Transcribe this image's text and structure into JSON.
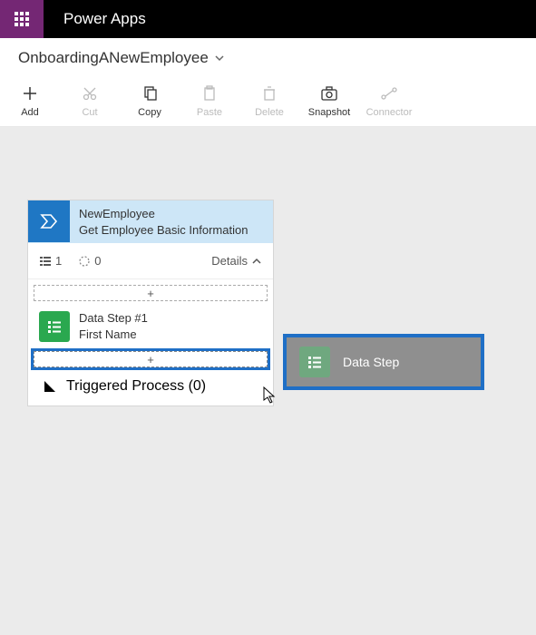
{
  "header": {
    "app_title": "Power Apps"
  },
  "breadcrumb": {
    "title": "OnboardingANewEmployee"
  },
  "toolbar": {
    "add": "Add",
    "cut": "Cut",
    "copy": "Copy",
    "paste": "Paste",
    "delete": "Delete",
    "snapshot": "Snapshot",
    "connector": "Connector"
  },
  "stage": {
    "title_line1": "NewEmployee",
    "title_line2": "Get Employee Basic Information",
    "meta": {
      "steps_count": "1",
      "pending_count": "0",
      "details_label": "Details"
    },
    "dropzone_plus": "+",
    "datastep": {
      "line1": "Data Step #1",
      "line2": "First Name"
    },
    "dropzone_plus_active": "+",
    "triggered": "Triggered Process (0)"
  },
  "drag_ghost": {
    "label": "Data Step"
  }
}
